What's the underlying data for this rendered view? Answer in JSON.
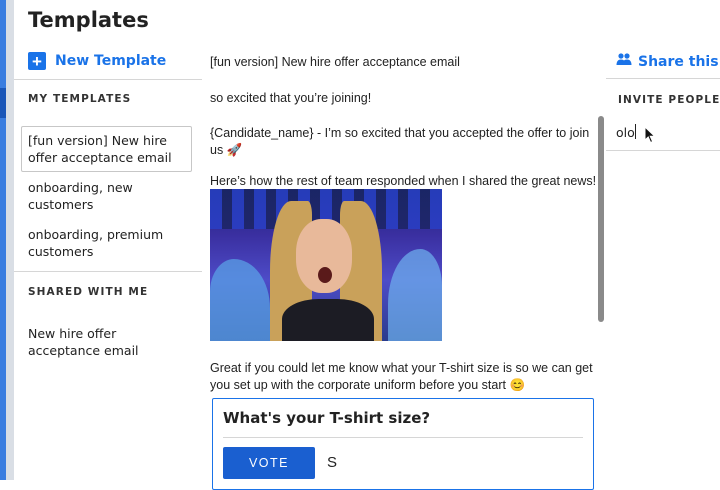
{
  "app": {
    "title": "Templates"
  },
  "sidebar": {
    "new_template_label": "New Template",
    "my_templates_heading": "MY TEMPLATES",
    "my_templates": [
      {
        "label": "[fun version] New hire offer acceptance email",
        "selected": true
      },
      {
        "label": "onboarding, new customers",
        "selected": false
      },
      {
        "label": "onboarding, premium customers",
        "selected": false
      }
    ],
    "shared_heading": "SHARED WITH ME",
    "shared_templates": [
      {
        "label": "New hire offer acceptance email"
      }
    ]
  },
  "editor": {
    "subject": "[fun version] New hire offer acceptance email",
    "greeting": "so excited that you’re joining!",
    "intro": "{Candidate_name} - I’m so excited that you accepted the offer to join us 🚀",
    "team_line": "Here’s how the rest of team responded when I shared the great news!",
    "tshirt_request": "Great if you could let me know what your T-shirt size is so we can get you set up with the corporate uniform before you start 😊",
    "poll": {
      "question": "What's your T-shirt size?",
      "vote_label": "VOTE",
      "visible_option": "S"
    }
  },
  "share_panel": {
    "share_label": "Share this tem",
    "invite_heading": "INVITE PEOPLE",
    "invite_value": "olo"
  },
  "colors": {
    "accent": "#1a73e8",
    "vote_button": "#1a5fd0",
    "left_strip": "#3a7de0"
  },
  "icons": {
    "new_template": "plus-icon",
    "share": "people-icon",
    "pointer": "mouse-pointer-icon"
  }
}
